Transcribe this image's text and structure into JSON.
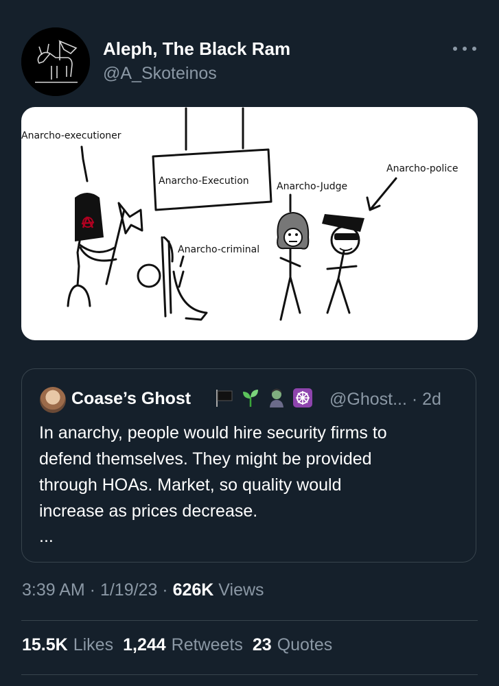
{
  "author": {
    "display_name": "Aleph, The Black Ram",
    "handle": "@A_Skoteinos",
    "avatar_icon": "black-ram-avatar"
  },
  "media": {
    "labels": {
      "executioner": "Anarcho-executioner",
      "execution": "Anarcho-Execution",
      "judge": "Anarcho-Judge",
      "police": "Anarcho-police",
      "criminal": "Anarcho-criminal"
    }
  },
  "quoted_tweet": {
    "display_name": "Coase’s Ghost",
    "emoji_icons": [
      "black-flag-icon",
      "seedling-icon",
      "zombie-icon",
      "dharma-wheel-icon"
    ],
    "handle_time": "@Ghost... · 2d",
    "text": "In anarchy, people would hire security firms to\ndefend themselves. They might be provided\nthrough HOAs. Market, so quality would\nincrease as prices decrease.",
    "ellipsis": "..."
  },
  "meta": {
    "time_date": "3:39 AM · 1/19/23 · ",
    "views_count": "626K",
    "views_label": " Views"
  },
  "stats": {
    "likes_count": "15.5K",
    "likes_label": "Likes",
    "retweets_count": "1,244",
    "retweets_label": "Retweets",
    "quotes_count": "23",
    "quotes_label": "Quotes"
  },
  "colors": {
    "background": "#15202b",
    "secondary_text": "#8b98a5",
    "border": "#38444d"
  }
}
